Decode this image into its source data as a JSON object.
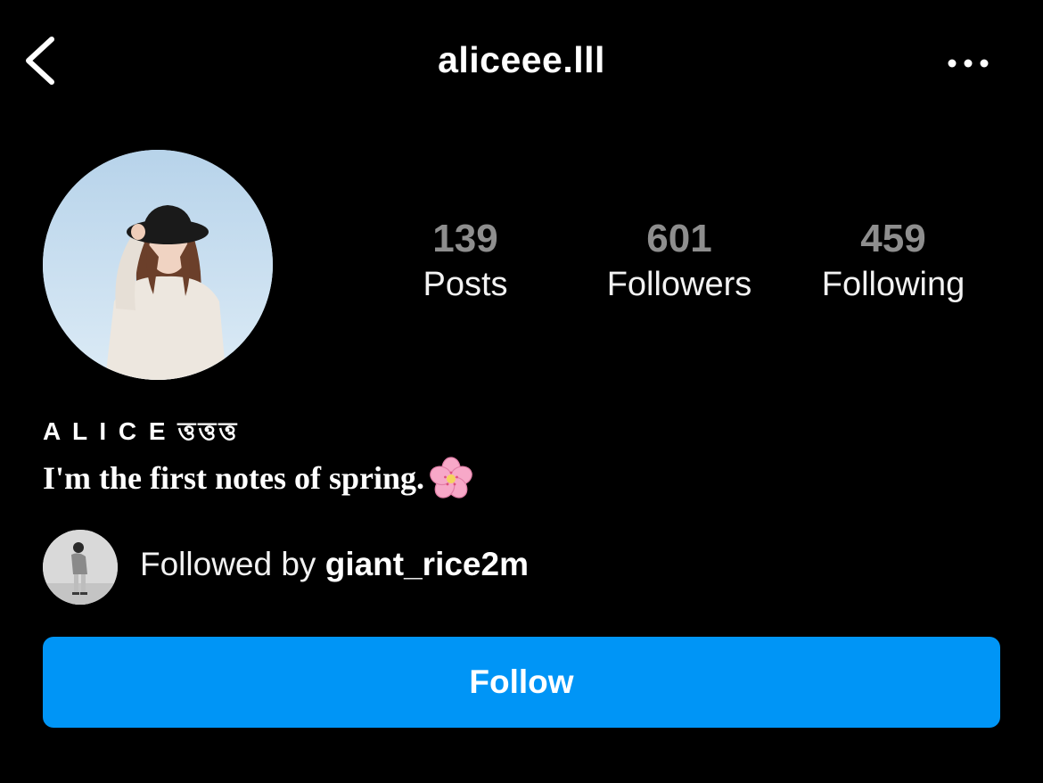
{
  "header": {
    "username": "aliceee.lll",
    "back_icon": "chevron-left-icon",
    "more_icon": "more-horizontal-icon"
  },
  "profile": {
    "avatar_icon": "profile-photo",
    "stats": [
      {
        "count": "139",
        "label": "Posts"
      },
      {
        "count": "601",
        "label": "Followers"
      },
      {
        "count": "459",
        "label": "Following"
      }
    ],
    "display_name": "A L I C E ত্তত্তত্ত",
    "bio": "I'm the first notes of spring.",
    "bio_emoji": "cherry-blossom-icon"
  },
  "mutual": {
    "prefix": "Followed by ",
    "username": "giant_rice2m",
    "avatar_icon": "mutual-follower-avatar"
  },
  "follow_button": {
    "label": "Follow"
  },
  "colors": {
    "background": "#000000",
    "accent": "#0095f6",
    "count_gray": "#8e8e8e",
    "text": "#ffffff"
  }
}
